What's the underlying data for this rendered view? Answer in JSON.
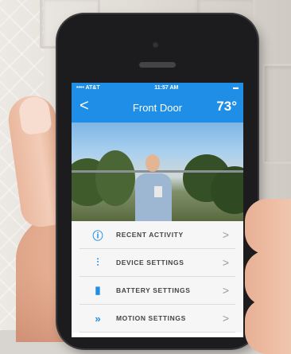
{
  "status_bar": {
    "carrier": "•••• AT&T",
    "time": "11:57 AM",
    "battery": "▬"
  },
  "header": {
    "back": "<",
    "title": "Front Door",
    "temperature": "73°"
  },
  "menu": {
    "items": [
      {
        "label": "RECENT ACTIVITY",
        "icon": "info-icon",
        "glyph": "ⓘ"
      },
      {
        "label": "DEVICE SETTINGS",
        "icon": "sliders-icon",
        "glyph": "⫶"
      },
      {
        "label": "BATTERY SETTINGS",
        "icon": "battery-icon",
        "glyph": "▮"
      },
      {
        "label": "MOTION SETTINGS",
        "icon": "motion-icon",
        "glyph": "»"
      }
    ],
    "chevron": ">"
  },
  "colors": {
    "accent": "#1f8ee6"
  }
}
